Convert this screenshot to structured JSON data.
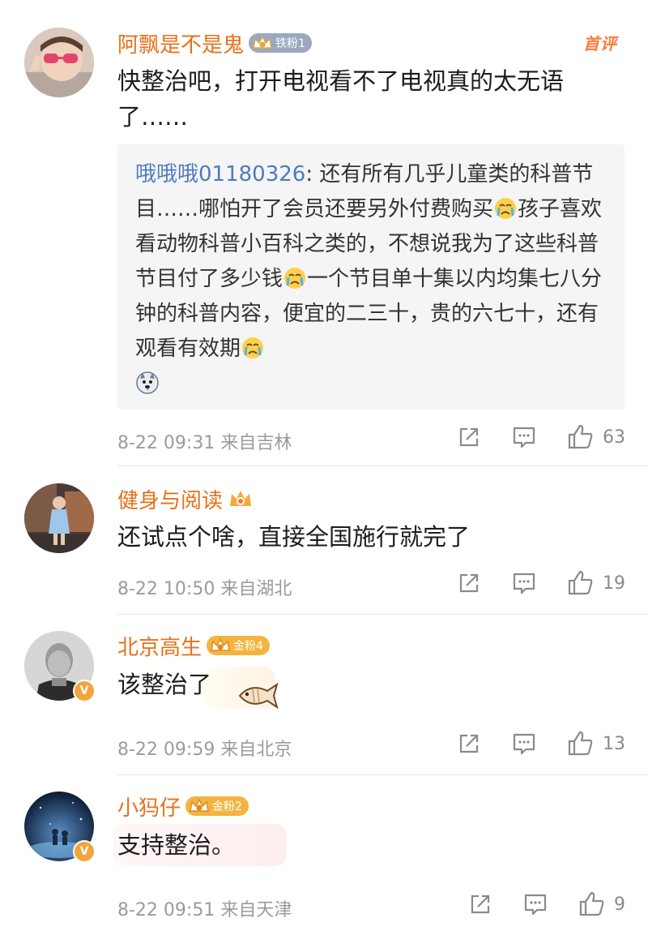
{
  "comments": [
    {
      "username": "阿飘是不是鬼",
      "fan_badge": "铁粉1",
      "first_tag": "首评",
      "text": "快整治吧，打开电视看不了电视真的太无语了……",
      "quote": {
        "username": "哦哦哦01180326",
        "text": "还有所有几乎儿童类的科普节目……哪怕开了会员还要另外付费购买",
        "text2": "孩子喜欢看动物科普小百科之类的，不想说我为了这些科普节目付了多少钱",
        "text3": "一个节目单十集以内均集七八分钟的科普内容，便宜的二三十，贵的六七十，还有观看有效期"
      },
      "time": "8-22 09:31",
      "location": "来自吉林",
      "likes": "63"
    },
    {
      "username": "健身与阅读",
      "text": "还试点个啥，直接全国施行就完了",
      "time": "8-22 10:50",
      "location": "来自湖北",
      "likes": "19"
    },
    {
      "username": "北京高生",
      "fan_badge": "金粉4",
      "text": "该整治了",
      "time": "8-22 09:59",
      "location": "来自北京",
      "likes": "13"
    },
    {
      "username": "小犸仔",
      "fan_badge": "金粉2",
      "text": "支持整治。",
      "time": "8-22 09:51",
      "location": "来自天津",
      "likes": "9"
    }
  ],
  "colors": {
    "username": "#e8701a",
    "quote_username": "#4d7bbd",
    "meta": "#9b9b9b",
    "iron_fan": "#9aa9bf",
    "gold_fan": "#f4b43f"
  },
  "icons": {
    "share": "share-icon",
    "reply": "comment-icon",
    "like": "thumbs-up-icon",
    "verified": "verified-v-badge-icon",
    "crown": "fan-crown-icon"
  }
}
